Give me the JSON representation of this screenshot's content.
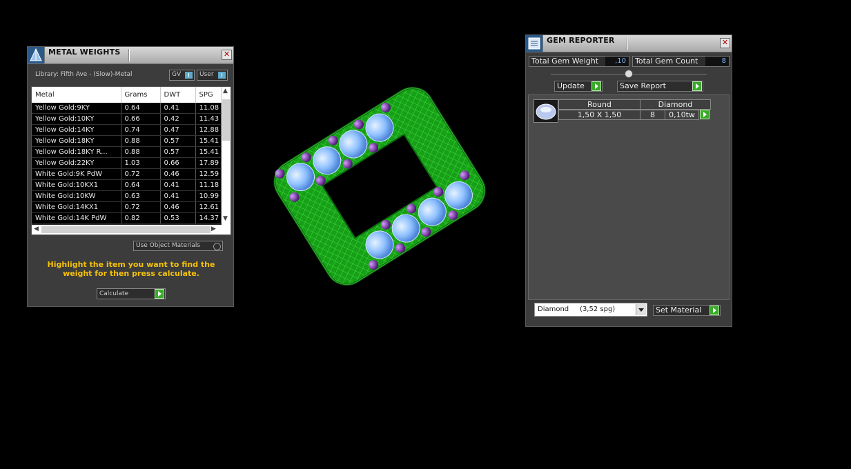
{
  "metal_weights": {
    "title": "METAL WEIGHTS",
    "library": "Library: Fifth Ave - (Slow)-Metal",
    "toggle_gv": "GV",
    "toggle_user": "User",
    "columns": [
      "Metal",
      "Grams",
      "DWT",
      "SPG"
    ],
    "rows": [
      [
        "Yellow Gold:9KY",
        "0.64",
        "0.41",
        "11.08"
      ],
      [
        "Yellow Gold:10KY",
        "0.66",
        "0.42",
        "11.43"
      ],
      [
        "Yellow Gold:14KY",
        "0.74",
        "0.47",
        "12.88"
      ],
      [
        "Yellow Gold:18KY",
        "0.88",
        "0.57",
        "15.41"
      ],
      [
        "Yellow Gold:18KY R...",
        "0.88",
        "0.57",
        "15.41"
      ],
      [
        "Yellow Gold:22KY",
        "1.03",
        "0.66",
        "17.89"
      ],
      [
        "White Gold:9K PdW",
        "0.72",
        "0.46",
        "12.59"
      ],
      [
        "White Gold:10KX1",
        "0.64",
        "0.41",
        "11.18"
      ],
      [
        "White Gold:10KW",
        "0.63",
        "0.41",
        "10.99"
      ],
      [
        "White Gold:14KX1",
        "0.72",
        "0.46",
        "12.61"
      ],
      [
        "White Gold:14K PdW",
        "0.82",
        "0.53",
        "14.37"
      ]
    ],
    "use_object_materials": "Use Object Materials",
    "hint": "Highlight the item you want to find the weight for then press calculate.",
    "calculate": "Calculate"
  },
  "gem_reporter": {
    "title": "GEM REPORTER",
    "total_weight_label": "Total Gem Weight",
    "total_weight_value": ",10",
    "total_count_label": "Total Gem Count",
    "total_count_value": "8",
    "update": "Update",
    "save_report": "Save Report",
    "gem": {
      "shape": "Round",
      "material": "Diamond",
      "size": "1,50 X 1,50",
      "count": "8",
      "weight": "0,10tw"
    },
    "material_select": "Diamond     (3,52 spg)",
    "set_material": "Set Material"
  },
  "colors": {
    "hint": "#f5c20a",
    "accent_green": "#3aaa2a",
    "ring_green": "#2bd42b",
    "gem_blue": "#8ec0ff",
    "bead_purple": "#7a2aa0"
  }
}
